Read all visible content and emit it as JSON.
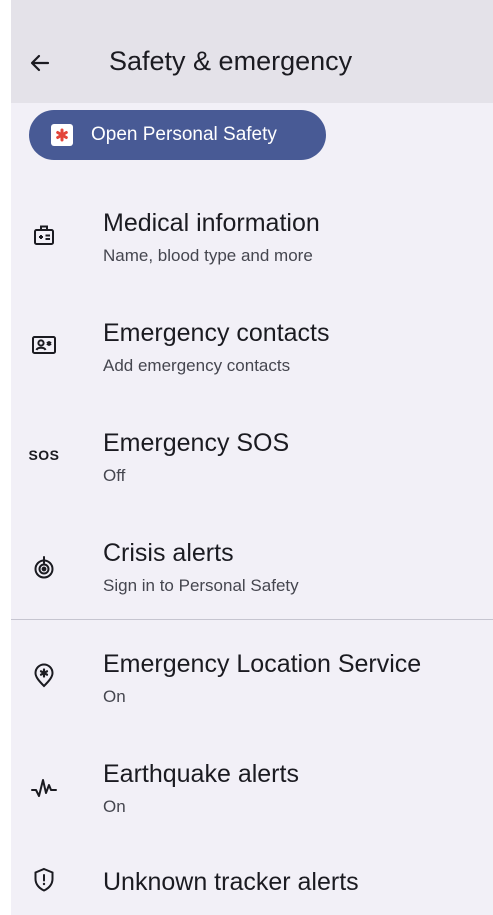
{
  "header": {
    "title": "Safety & emergency",
    "back_icon": "arrow-back-icon"
  },
  "chip": {
    "label": "Open Personal Safety",
    "icon": "personal-safety-app-icon",
    "colors": {
      "background": "#485a95",
      "icon_star": "#e3453a"
    }
  },
  "items": [
    {
      "title": "Medical information",
      "subtitle": "Name, blood type and more",
      "icon": "medical-id-icon"
    },
    {
      "title": "Emergency contacts",
      "subtitle": "Add emergency contacts",
      "icon": "contact-card-icon"
    },
    {
      "title": "Emergency SOS",
      "subtitle": "Off",
      "icon": "sos-icon",
      "icon_text": "SOS"
    },
    {
      "title": "Crisis alerts",
      "subtitle": "Sign in to Personal Safety",
      "icon": "crisis-alert-icon"
    },
    {
      "title": "Emergency Location Service",
      "subtitle": "On",
      "icon": "location-service-icon"
    },
    {
      "title": "Earthquake alerts",
      "subtitle": "On",
      "icon": "earthquake-icon"
    },
    {
      "title": "Unknown tracker alerts",
      "icon": "tracker-shield-icon"
    }
  ]
}
